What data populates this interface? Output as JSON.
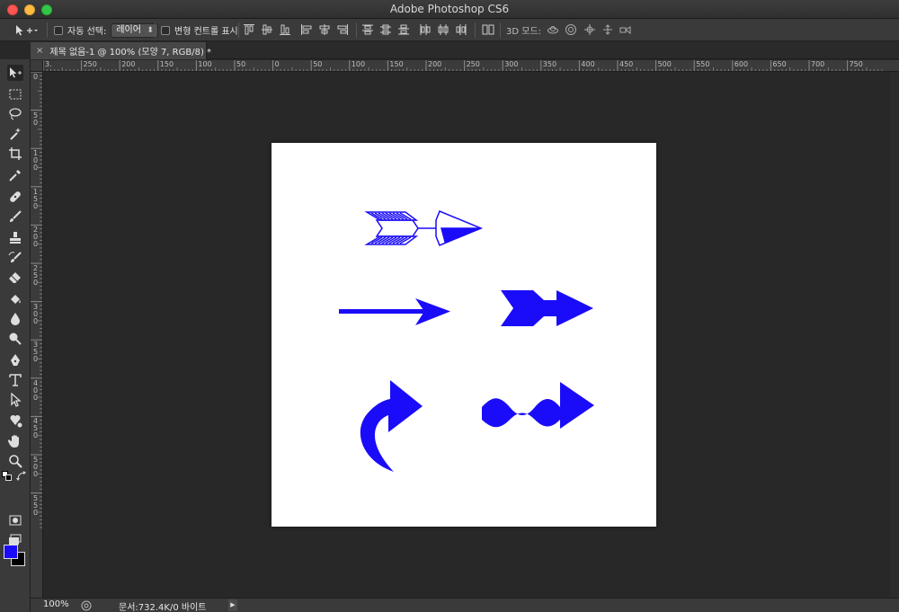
{
  "window": {
    "title": "Adobe Photoshop CS6"
  },
  "options_bar": {
    "auto_select_label": "자동 선택:",
    "auto_select_value": "레이어",
    "show_transform_label": "변형 컨트롤 표시",
    "mode_3d_label": "3D 모드:"
  },
  "document": {
    "tab_label": "제목 없음-1 @ 100% (모양 7, RGB/8) *",
    "close_glyph": "×"
  },
  "ruler_top": [
    "3.",
    "250",
    "200",
    "150",
    "100",
    "50",
    "0",
    "50",
    "100",
    "150",
    "200",
    "250",
    "300",
    "350",
    "400",
    "450",
    "500",
    "550",
    "600",
    "650",
    "700",
    "750"
  ],
  "ruler_left": [
    "0",
    "50",
    "100",
    "150",
    "200",
    "250",
    "300",
    "350",
    "400",
    "450",
    "500",
    "550"
  ],
  "toolbox": {
    "foreground_color": "#1a0cf8",
    "background_color": "#000000",
    "tools": [
      "move-tool",
      "marquee-tool",
      "lasso-tool",
      "magic-wand-tool",
      "crop-tool",
      "eyedropper-tool",
      "healing-brush-tool",
      "brush-tool",
      "clone-stamp-tool",
      "history-brush-tool",
      "eraser-tool",
      "paint-bucket-tool",
      "blur-tool",
      "dodge-tool",
      "pen-tool",
      "type-tool",
      "path-selection-tool",
      "custom-shape-tool",
      "hand-tool",
      "zoom-tool"
    ]
  },
  "canvas": {
    "shape_color": "#1a0cf8",
    "shapes": [
      "feathered-arrow",
      "thin-arrow",
      "notched-arrow",
      "curved-arrow",
      "wavy-arrow"
    ]
  },
  "status": {
    "zoom": "100%",
    "doc_info": "문서:732.4K/0 바이트",
    "arrow": "▶"
  }
}
